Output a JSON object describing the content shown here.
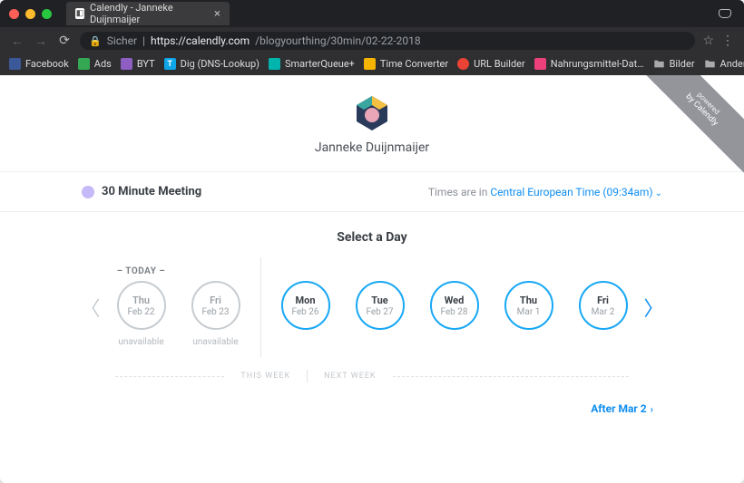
{
  "browser": {
    "tab_title": "Calendly - Janneke Duijnmaijer",
    "secure_label": "Sicher",
    "url_host": "https://calendly.com",
    "url_path": "/blogyourthing/30min/02-22-2018",
    "bookmarks": [
      {
        "label": "Facebook"
      },
      {
        "label": "Ads"
      },
      {
        "label": "BYT"
      },
      {
        "label": "Dig (DNS-Lookup)"
      },
      {
        "label": "SmarterQueue+"
      },
      {
        "label": "Time Converter"
      },
      {
        "label": "URL Builder"
      },
      {
        "label": "Nahrungsmittel-Dat…"
      },
      {
        "label": "Bilder"
      }
    ],
    "other_bookmarks_label": "Andere Lesezeichen"
  },
  "banner": {
    "line1": "powered",
    "line2": "by Calendly"
  },
  "profile": {
    "name": "Janneke Duijnmaijer"
  },
  "meeting": {
    "name": "30 Minute Meeting",
    "color": "#c6b9f7",
    "tz_prefix": "Times are in ",
    "tz_name": "Central European Time",
    "tz_time": "(09:34am)"
  },
  "select_day_title": "Select a Day",
  "today_label": "– TODAY –",
  "unavailable_label": "unavailable",
  "this_week_label": "THIS WEEK",
  "next_week_label": "NEXT WEEK",
  "after_link_label": "After Mar 2",
  "days_this_week": [
    {
      "dow": "Thu",
      "date": "Feb 22",
      "available": false,
      "is_today": true
    },
    {
      "dow": "Fri",
      "date": "Feb 23",
      "available": false,
      "is_today": false
    }
  ],
  "days_next_week": [
    {
      "dow": "Mon",
      "date": "Feb 26",
      "available": true
    },
    {
      "dow": "Tue",
      "date": "Feb 27",
      "available": true
    },
    {
      "dow": "Wed",
      "date": "Feb 28",
      "available": true
    },
    {
      "dow": "Thu",
      "date": "Mar 1",
      "available": true
    },
    {
      "dow": "Fri",
      "date": "Mar 2",
      "available": true
    }
  ]
}
